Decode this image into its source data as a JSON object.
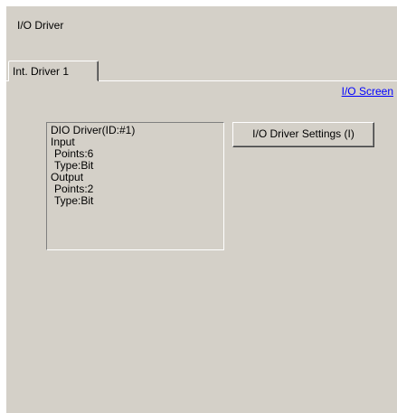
{
  "panel": {
    "title": "I/O Driver"
  },
  "tabs": [
    {
      "label": "Int. Driver 1",
      "selected": true
    }
  ],
  "io_screen_link": "I/O Screen",
  "driver_info": {
    "lines": [
      "DIO Driver(ID:#1)",
      "Input",
      " Points:6",
      " Type:Bit",
      "Output",
      " Points:2",
      " Type:Bit"
    ]
  },
  "settings_button": {
    "label": "I/O Driver Settings (I)"
  },
  "colors": {
    "panel_bg": "#d4d0c8",
    "link": "#0000ff"
  }
}
